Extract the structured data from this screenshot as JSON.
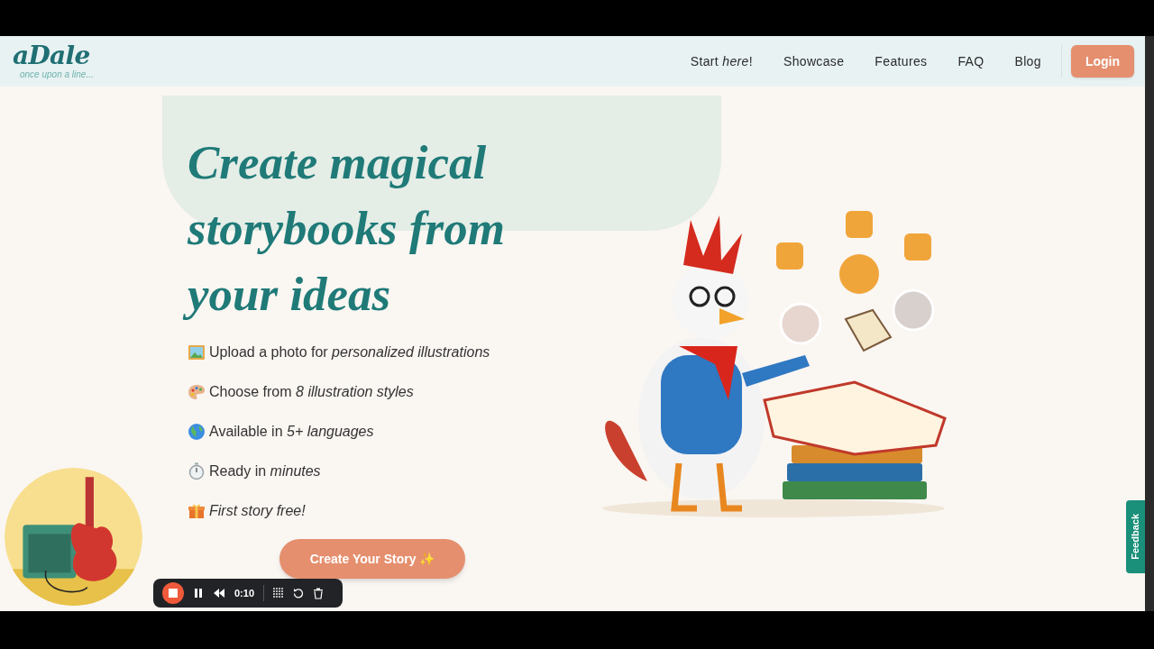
{
  "header": {
    "logo": "aDale",
    "tagline": "once upon a line...",
    "nav": [
      {
        "label": "Start *here*!"
      },
      {
        "label": "Showcase"
      },
      {
        "label": "Features"
      },
      {
        "label": "FAQ"
      },
      {
        "label": "Blog"
      }
    ],
    "login": "Login"
  },
  "hero": {
    "title_lines": [
      "Create magical",
      "storybooks from",
      "your ideas"
    ],
    "features": [
      {
        "kind": "picture",
        "text": "Upload a photo for *personalized illustrations*"
      },
      {
        "kind": "palette",
        "text": "Choose from *8 illustration styles*"
      },
      {
        "kind": "globe",
        "text": "Available in *5+ languages*"
      },
      {
        "kind": "stopwatch",
        "text": "Ready in *minutes*"
      },
      {
        "kind": "gift",
        "text": "*First story free!*"
      }
    ],
    "cta": "Create Your Story ✨"
  },
  "recorder": {
    "time": "0:10"
  },
  "feedback_tab": "Feedback"
}
